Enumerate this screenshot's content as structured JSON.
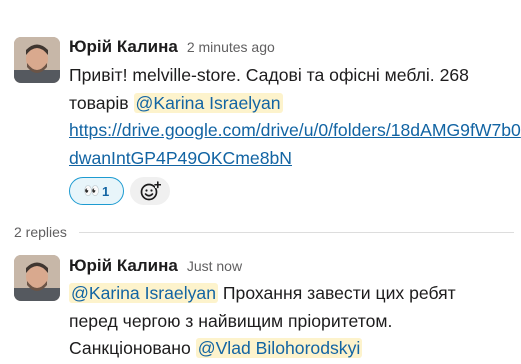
{
  "messages": [
    {
      "author": "Юрій Калина",
      "time": "2 minutes ago",
      "text_1": "Привіт! melville-store. Садові та офісні меблі. 268 товарів",
      "mention": "@Karina Israelyan",
      "link": "https://drive.google.com/drive/u/0/folders/18dAMG9fW7b0dwanIntGP4P49OKCme8bN",
      "reactions": [
        {
          "emoji": "👀",
          "count": "1",
          "icon": "eyes-icon"
        }
      ],
      "add_reaction_icon": "add-emoji-icon"
    }
  ],
  "thread": {
    "replies_label": "2 replies"
  },
  "replies": [
    {
      "author": "Юрій Калина",
      "time": "Just now",
      "mention_1": "@Karina Israelyan",
      "text_1": "Прохання завести цих ребят перед чергою з найвищим пріоритетом. Санкціоновано",
      "mention_2": "@Vlad Bilohorodskyi"
    }
  ],
  "colors": {
    "link": "#1264a3",
    "mention_bg": "#fdf3cc",
    "reaction_border": "#1d9bd1",
    "reaction_bg": "#e8f5fa"
  }
}
